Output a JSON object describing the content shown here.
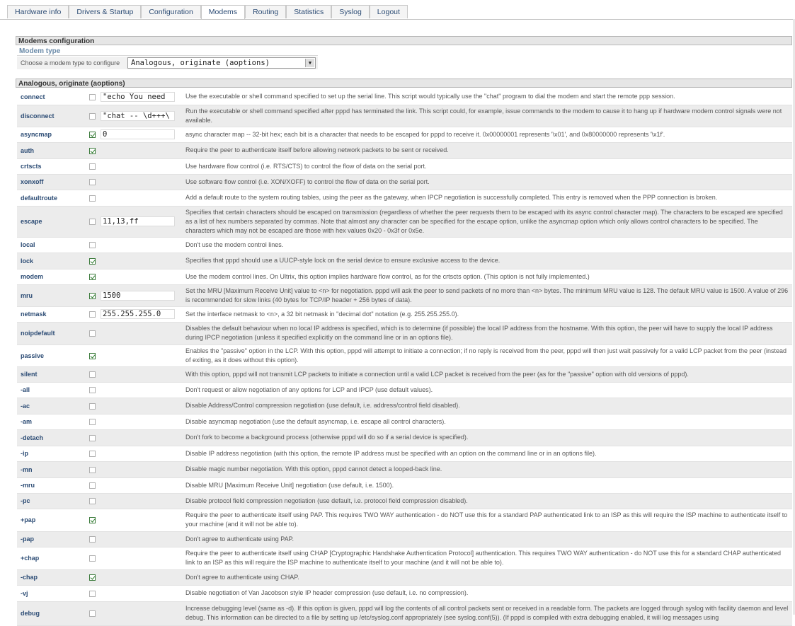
{
  "tabs": [
    {
      "label": "Hardware info",
      "active": false
    },
    {
      "label": "Drivers & Startup",
      "active": false
    },
    {
      "label": "Configuration",
      "active": false
    },
    {
      "label": "Modems",
      "active": true
    },
    {
      "label": "Routing",
      "active": false
    },
    {
      "label": "Statistics",
      "active": false
    },
    {
      "label": "Syslog",
      "active": false
    },
    {
      "label": "Logout",
      "active": false
    }
  ],
  "config": {
    "title": "Modems configuration",
    "modem_type_label": "Modem type",
    "choose_label": "Choose a modem type to configure",
    "selected_type": "Analogous, originate (aoptions)"
  },
  "options_title": "Analogous, originate (aoptions)",
  "options": [
    {
      "name": "connect",
      "checked": false,
      "value": "\"echo You need",
      "desc": "Use the executable or shell command specified to set up the serial line. This script would typically use the \"chat\" program to dial the modem and start the remote ppp session."
    },
    {
      "name": "disconnect",
      "checked": false,
      "value": "\"chat -- \\d+++\\",
      "desc": "Run the executable or shell command specified after pppd has terminated the link. This script could, for example, issue commands to the modem to cause it to hang up if hardware modem control signals were not available."
    },
    {
      "name": "asyncmap",
      "checked": true,
      "value": "0",
      "desc": "async character map -- 32-bit hex; each bit is a character that needs to be escaped for pppd to receive it. 0x00000001 represents '\\x01', and 0x80000000 represents '\\x1f'."
    },
    {
      "name": "auth",
      "checked": true,
      "value": null,
      "desc": "Require the peer to authenticate itself before allowing network packets to be sent or received."
    },
    {
      "name": "crtscts",
      "checked": false,
      "value": null,
      "desc": "Use hardware flow control (i.e. RTS/CTS) to control the flow of data on the serial port."
    },
    {
      "name": "xonxoff",
      "checked": false,
      "value": null,
      "desc": "Use software flow control (i.e. XON/XOFF) to control the flow of data on the serial port."
    },
    {
      "name": "defaultroute",
      "checked": false,
      "value": null,
      "desc": "Add a default route to the system routing tables, using the peer as the gateway, when IPCP negotiation is successfully completed. This entry is removed when the PPP connection is broken."
    },
    {
      "name": "escape",
      "checked": false,
      "value": "11,13,ff",
      "desc": "Specifies that certain characters should be escaped on transmission (regardless of whether the peer requests them to be escaped with its async control character map). The characters to be escaped are specified as a list of hex numbers separated by commas. Note that almost any character can be specified for the escape option, unlike the asyncmap option which only allows control characters to be specified. The characters which may not be escaped are those with hex values 0x20 - 0x3f or 0x5e."
    },
    {
      "name": "local",
      "checked": false,
      "value": null,
      "desc": "Don't use the modem control lines."
    },
    {
      "name": "lock",
      "checked": true,
      "value": null,
      "desc": "Specifies that pppd should use a UUCP-style lock on the serial device to ensure exclusive access to the device."
    },
    {
      "name": "modem",
      "checked": true,
      "value": null,
      "desc": "Use the modem control lines. On Ultrix, this option implies hardware flow control, as for the crtscts option. (This option is not fully implemented.)"
    },
    {
      "name": "mru",
      "checked": true,
      "value": "1500",
      "desc": "Set the MRU [Maximum Receive Unit] value to <n> for negotiation. pppd will ask the peer to send packets of no more than <n> bytes. The minimum MRU value is 128. The default MRU value is 1500. A value of 296 is recommended for slow links (40 bytes for TCP/IP header + 256 bytes of data)."
    },
    {
      "name": "netmask",
      "checked": false,
      "value": "255.255.255.0",
      "desc": "Set the interface netmask to <n>, a 32 bit netmask in \"decimal dot\" notation (e.g. 255.255.255.0)."
    },
    {
      "name": "noipdefault",
      "checked": false,
      "value": null,
      "desc": "Disables the default behaviour when no local IP address is specified, which is to determine (if possible) the local IP address from the hostname. With this option, the peer will have to supply the local IP address during IPCP negotiation (unless it specified explicitly on the command line or in an options file)."
    },
    {
      "name": "passive",
      "checked": true,
      "value": null,
      "desc": "Enables the \"passive\" option in the LCP. With this option, pppd will attempt to initiate a connection; if no reply is received from the peer, pppd will then just wait passively for a valid LCP packet from the peer (instead of exiting, as it does without this option)."
    },
    {
      "name": "silent",
      "checked": false,
      "value": null,
      "desc": "With this option, pppd will not transmit LCP packets to initiate a connection until a valid LCP packet is received from the peer (as for the \"passive\" option with old versions of pppd)."
    },
    {
      "name": "-all",
      "checked": false,
      "value": null,
      "desc": "Don't request or allow negotiation of any options for LCP and IPCP (use default values)."
    },
    {
      "name": "-ac",
      "checked": false,
      "value": null,
      "desc": "Disable Address/Control compression negotiation (use default, i.e. address/control field disabled)."
    },
    {
      "name": "-am",
      "checked": false,
      "value": null,
      "desc": "Disable asyncmap negotiation (use the default asyncmap, i.e. escape all control characters)."
    },
    {
      "name": "-detach",
      "checked": false,
      "value": null,
      "desc": "Don't fork to become a background process (otherwise pppd will do so if a serial device is specified)."
    },
    {
      "name": "-ip",
      "checked": false,
      "value": null,
      "desc": "Disable IP address negotiation (with this option, the remote IP address must be specified with an option on the command line or in an options file)."
    },
    {
      "name": "-mn",
      "checked": false,
      "value": null,
      "desc": "Disable magic number negotiation. With this option, pppd cannot detect a looped-back line."
    },
    {
      "name": "-mru",
      "checked": false,
      "value": null,
      "desc": "Disable MRU [Maximum Receive Unit] negotiation (use default, i.e. 1500)."
    },
    {
      "name": "-pc",
      "checked": false,
      "value": null,
      "desc": "Disable protocol field compression negotiation (use default, i.e. protocol field compression disabled)."
    },
    {
      "name": "+pap",
      "checked": true,
      "value": null,
      "desc": "Require the peer to authenticate itself using PAP. This requires TWO WAY authentication - do NOT use this for a standard PAP authenticated link to an ISP as this will require the ISP machine to authenticate itself to your machine (and it will not be able to)."
    },
    {
      "name": "-pap",
      "checked": false,
      "value": null,
      "desc": "Don't agree to authenticate using PAP."
    },
    {
      "name": "+chap",
      "checked": false,
      "value": null,
      "desc": "Require the peer to authenticate itself using CHAP [Cryptographic Handshake Authentication Protocol] authentication. This requires TWO WAY authentication - do NOT use this for a standard CHAP authenticated link to an ISP as this will require the ISP machine to authenticate itself to your machine (and it will not be able to)."
    },
    {
      "name": "-chap",
      "checked": true,
      "value": null,
      "desc": "Don't agree to authenticate using CHAP."
    },
    {
      "name": "-vj",
      "checked": false,
      "value": null,
      "desc": "Disable negotiation of Van Jacobson style IP header compression (use default, i.e. no compression)."
    },
    {
      "name": "debug",
      "checked": false,
      "value": null,
      "desc": "Increase debugging level (same as -d). If this option is given, pppd will log the contents of all control packets sent or received in a readable form. The packets are logged through syslog with facility daemon and level debug. This information can be directed to a file by setting up /etc/syslog.conf appropriately (see syslog.conf(5)). (If pppd is compiled with extra debugging enabled, it will log messages using"
    }
  ]
}
